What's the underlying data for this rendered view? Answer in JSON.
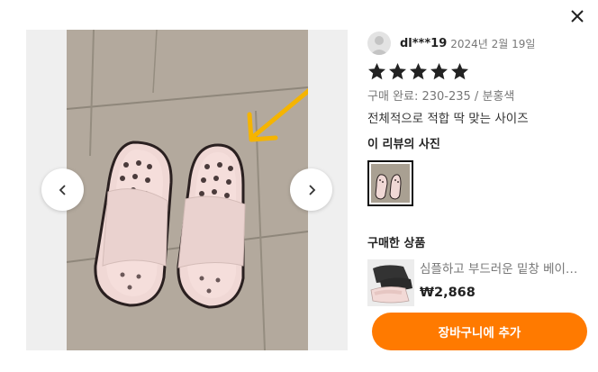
{
  "colors": {
    "accent": "#ff7a00",
    "star": "#222222",
    "arrow": "#f5b400"
  },
  "icons": {
    "close": "close-icon",
    "prev": "chevron-left-icon",
    "next": "chevron-right-icon",
    "star": "star-icon",
    "avatar": "avatar-placeholder-icon"
  },
  "review": {
    "reviewer_name": "dl***19",
    "date": "2024년 2월 19일",
    "rating": 5,
    "purchase_info": "구매 완료: 230-235 / 분홍색",
    "text": "전체적으로 적합 딱 맞는 사이즈"
  },
  "review_photos": {
    "title": "이 리뷰의 사진"
  },
  "purchased": {
    "title": "구매한 상품",
    "product_name": "심플하고 부드러운 밑창 베이직 슬리퍼",
    "price": "₩2,868"
  },
  "actions": {
    "add_to_cart": "장바구니에 추가"
  }
}
